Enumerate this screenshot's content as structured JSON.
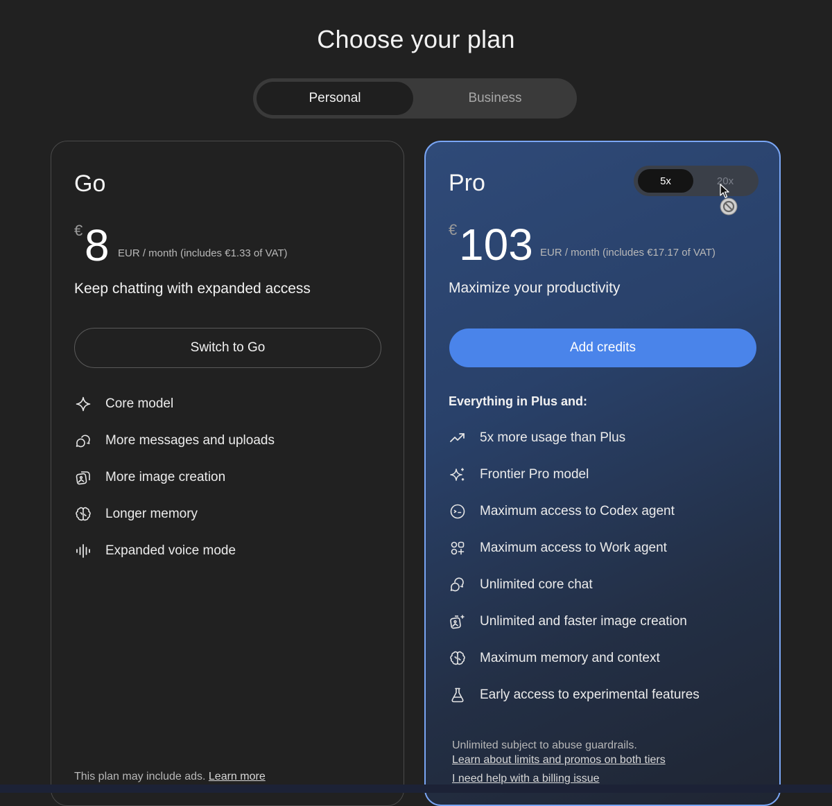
{
  "page": {
    "title": "Choose your plan"
  },
  "plan_type_toggle": {
    "options": [
      "Personal",
      "Business"
    ],
    "selected": "Personal"
  },
  "go_plan": {
    "name": "Go",
    "currency_symbol": "€",
    "price": "8",
    "price_note": "EUR / month (includes €1.33 of VAT)",
    "tagline": "Keep chatting with expanded access",
    "button_label": "Switch to Go",
    "features": [
      {
        "icon": "sparkle-icon",
        "label": "Core model"
      },
      {
        "icon": "chat-bubbles-icon",
        "label": "More messages and uploads"
      },
      {
        "icon": "image-stack-icon",
        "label": "More image creation"
      },
      {
        "icon": "brain-icon",
        "label": "Longer memory"
      },
      {
        "icon": "voice-wave-icon",
        "label": "Expanded voice mode"
      }
    ],
    "footer_text": "This plan may include ads.",
    "footer_link": "Learn more"
  },
  "pro_plan": {
    "name": "Pro",
    "multiplier_options": [
      "5x",
      "20x"
    ],
    "multiplier_selected": "5x",
    "currency_symbol": "€",
    "price": "103",
    "price_note": "EUR / month (includes €17.17 of VAT)",
    "tagline": "Maximize your productivity",
    "button_label": "Add credits",
    "features_heading": "Everything in Plus and:",
    "features": [
      {
        "icon": "trending-up-icon",
        "label": "5x more usage than Plus"
      },
      {
        "icon": "sparkles-icon",
        "label": "Frontier Pro model"
      },
      {
        "icon": "codex-face-icon",
        "label": "Maximum access to Codex agent"
      },
      {
        "icon": "agent-grid-icon",
        "label": "Maximum access to Work agent"
      },
      {
        "icon": "chat-bubbles-icon",
        "label": "Unlimited core chat"
      },
      {
        "icon": "image-sparkle-icon",
        "label": "Unlimited and faster image creation"
      },
      {
        "icon": "brain-icon",
        "label": "Maximum memory and context"
      },
      {
        "icon": "flask-icon",
        "label": "Early access to experimental features"
      }
    ],
    "guardrail_note": "Unlimited subject to abuse guardrails.",
    "limits_link": "Learn about limits and promos on both tiers",
    "billing_link": "I need help with a billing issue"
  },
  "colors": {
    "background": "#212121",
    "pro_border": "#7aa6f5",
    "primary_button": "#4a84ea"
  }
}
